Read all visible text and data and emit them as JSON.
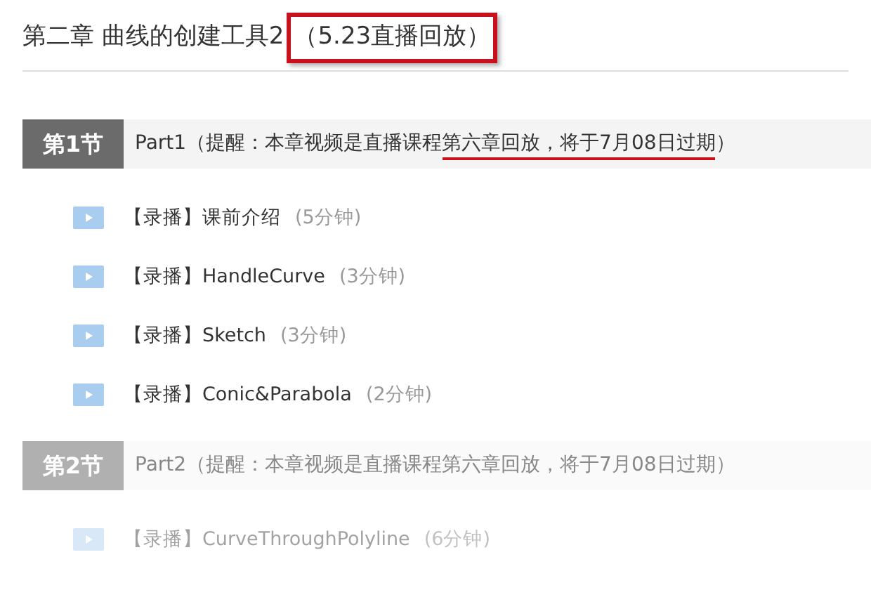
{
  "title": [
    {
      "text": "第二章 曲线的创建工具2",
      "boxed": false
    },
    {
      "text": "（5.23直播回放）",
      "boxed": true
    }
  ],
  "sections": [
    {
      "badge": "第1节",
      "faded": false,
      "heading": [
        {
          "text": "Part1（提醒：本章视频是直播课程",
          "underlined": false
        },
        {
          "text": "第六章回放，将于7月08日过期",
          "underlined": true
        },
        {
          "text": "）",
          "underlined": false
        }
      ],
      "lessons": [
        {
          "title": "【录播】课前介绍",
          "duration": "(5分钟)"
        },
        {
          "title": "【录播】HandleCurve",
          "duration": "(3分钟)"
        },
        {
          "title": "【录播】Sketch",
          "duration": "(3分钟)"
        },
        {
          "title": "【录播】Conic&Parabola",
          "duration": "(2分钟)"
        }
      ]
    },
    {
      "badge": "第2节",
      "faded": true,
      "heading": [
        {
          "text": "Part2（提醒：本章视频是直播课程第六章回放，将于7月08日过期）",
          "underlined": false
        }
      ],
      "lessons": [
        {
          "title": "【录播】CurveThroughPolyline",
          "duration": "(6分钟)"
        }
      ]
    }
  ]
}
